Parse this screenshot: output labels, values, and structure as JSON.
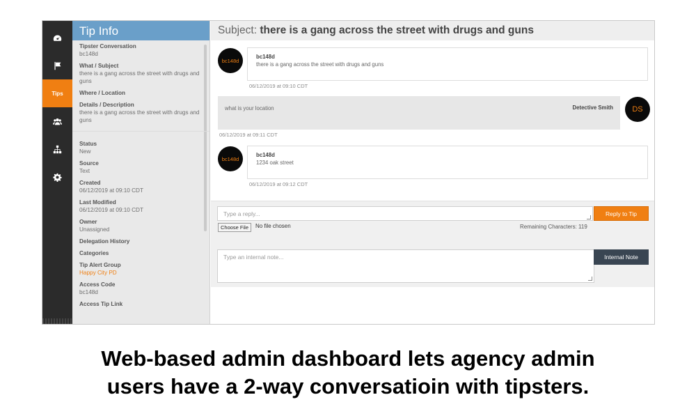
{
  "nav": {
    "items": [
      {
        "icon": "dashboard-icon",
        "label": ""
      },
      {
        "icon": "flag-icon",
        "label": ""
      },
      {
        "icon": "tips-icon",
        "label": "Tips"
      },
      {
        "icon": "users-icon",
        "label": ""
      },
      {
        "icon": "org-chart-icon",
        "label": ""
      },
      {
        "icon": "gear-icon",
        "label": ""
      }
    ],
    "active_color": "#f07f12"
  },
  "info": {
    "title": "Tip Info",
    "tipster_label": "Tipster Conversation",
    "tipster_value": "bc148d",
    "what_label": "What / Subject",
    "what_value": "there is a gang across the street with drugs and guns",
    "where_label": "Where / Location",
    "details_label": "Details / Description",
    "details_value": "there is a gang across the street with drugs and guns",
    "status_label": "Status",
    "status_value": "New",
    "source_label": "Source",
    "source_value": "Text",
    "created_label": "Created",
    "created_value": "06/12/2019 at 09:10 CDT",
    "modified_label": "Last Modified",
    "modified_value": "06/12/2019 at 09:10 CDT",
    "owner_label": "Owner",
    "owner_value": "Unassigned",
    "delegation_label": "Delegation History",
    "categories_label": "Categories",
    "alert_group_label": "Tip Alert Group",
    "alert_group_value": "Happy City PD",
    "access_code_label": "Access Code",
    "access_code_value": "bc148d",
    "access_link_label": "Access Tip Link"
  },
  "subject": {
    "prefix": "Subject:",
    "text": "there is a gang across the street with drugs and guns"
  },
  "messages": [
    {
      "avatar": "bc148d",
      "sender": "bc148d",
      "text": "there is a gang across the street with drugs and guns",
      "time": "06/12/2019 at 09:10 CDT"
    },
    {
      "avatar": "DS",
      "sender": "Detective Smith",
      "text": "what is your location",
      "time": "06/12/2019 at 09:11 CDT"
    },
    {
      "avatar": "bc148d",
      "sender": "bc148d",
      "text": "1234 oak street",
      "time": "06/12/2019 at 09:12 CDT"
    }
  ],
  "composer": {
    "reply_placeholder": "Type a reply...",
    "reply_button": "Reply to Tip",
    "choose_file": "Choose File",
    "no_file": "No file chosen",
    "remaining": "Remaining Characters: 119",
    "note_placeholder": "Type an internal note...",
    "note_button": "Internal Note"
  },
  "caption": {
    "line1": "Web-based admin dashboard lets agency admin",
    "line2": "users have a 2-way conversatioin with tipsters."
  }
}
